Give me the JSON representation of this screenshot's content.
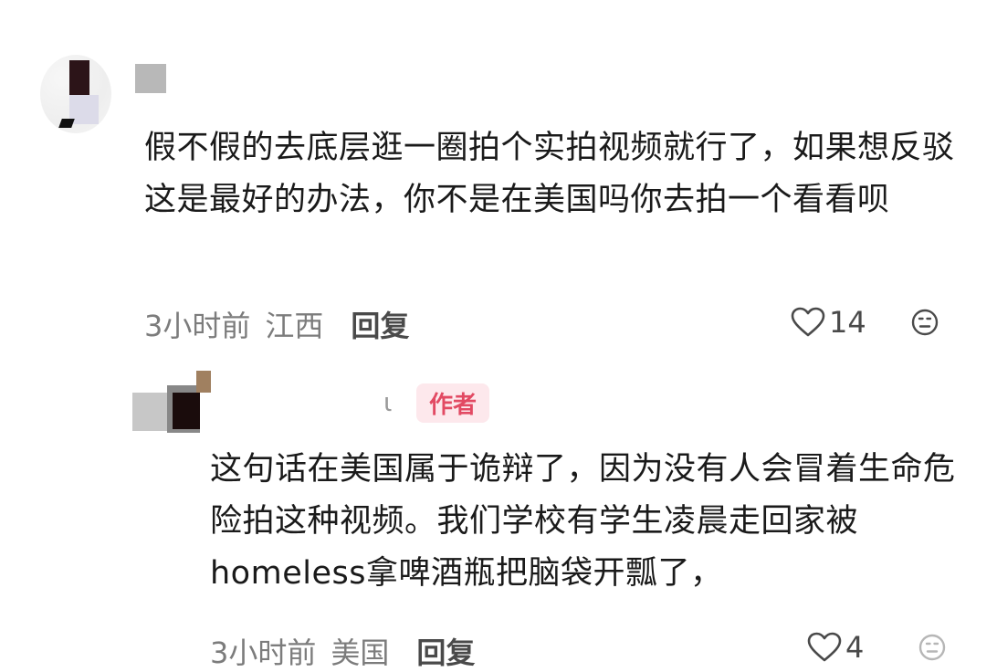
{
  "comments": [
    {
      "text": "假不假的去底层逛一圈拍个实拍视频就行了，如果想反驳这是最好的办法，你不是在美国吗你去拍一个看看呗",
      "time": "3小时前",
      "location": "江西",
      "reply_label": "回复",
      "likes": "14",
      "like_icon": "heart-outline-icon",
      "dislike_icon": "meh-face-icon"
    },
    {
      "author_name": "ι",
      "author_badge": "作者",
      "text": "这句话在美国属于诡辩了，因为没有人会冒着生命危险拍这种视频。我们学校有学生凌晨走回家被homeless拿啤酒瓶把脑袋开瓢了，",
      "time": "3小时前",
      "location": "美国",
      "reply_label": "回复",
      "likes": "4",
      "like_icon": "heart-outline-icon",
      "dislike_icon": "meh-face-icon"
    }
  ],
  "colors": {
    "badge_text": "#e24a63",
    "badge_bg": "#fde8ec",
    "meta_text": "#7c7c7c"
  }
}
